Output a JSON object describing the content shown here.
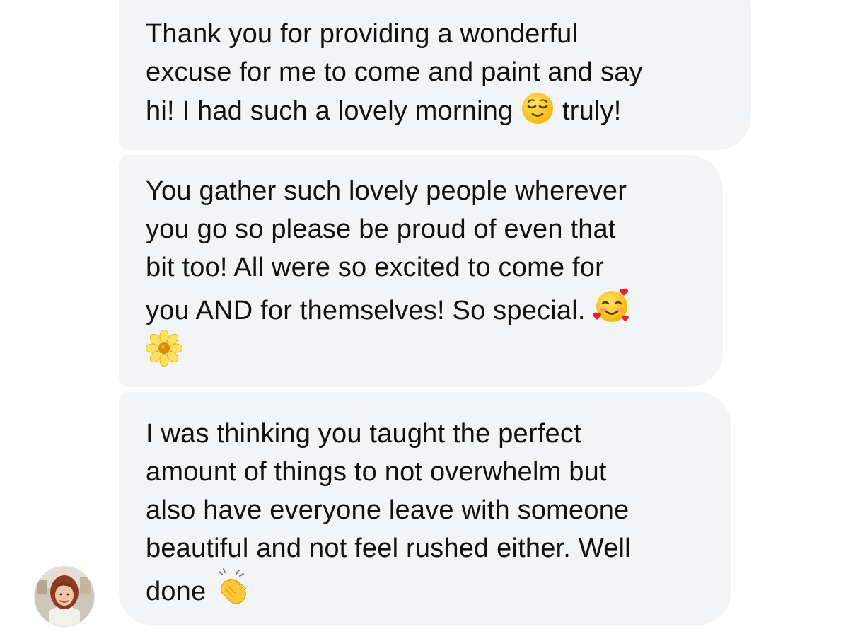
{
  "messages": [
    {
      "lines": [
        {
          "text": "Thank you for providing a wonderful"
        },
        {
          "text": "excuse for me to come and paint and say"
        },
        {
          "text": "hi! I had such a lovely morning ",
          "emoji": "relieved-face-icon",
          "after": " truly!"
        }
      ]
    },
    {
      "lines": [
        {
          "text": "You gather such lovely people wherever"
        },
        {
          "text": "you go so please be proud of even that"
        },
        {
          "text": "bit too! All were so excited to come for"
        },
        {
          "text": "you AND for themselves! So special. ",
          "emoji": "smiling-face-with-hearts-icon"
        },
        {
          "text": "",
          "emoji": "blossom-icon"
        }
      ]
    },
    {
      "lines": [
        {
          "text": "I was thinking you taught the perfect"
        },
        {
          "text": "amount of things to not overwhelm but"
        },
        {
          "text": "also have everyone leave with someone"
        },
        {
          "text": "beautiful and not feel rushed either. Well"
        },
        {
          "text": "done ",
          "emoji": "clapping-hands-icon"
        }
      ]
    }
  ],
  "colors": {
    "bubble": "#f3f4f6",
    "text": "#111111"
  }
}
